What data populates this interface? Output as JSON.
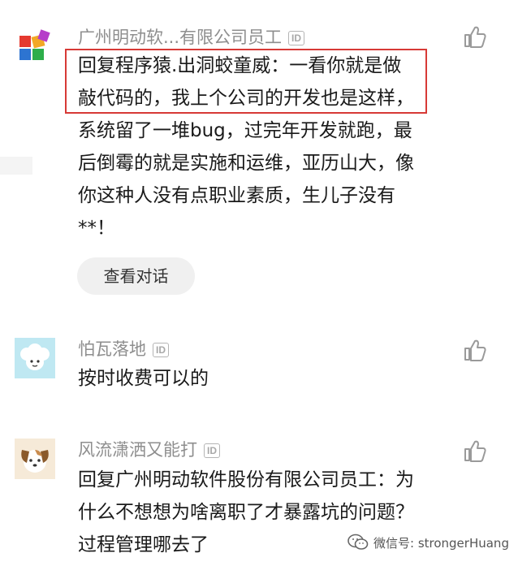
{
  "comments": [
    {
      "author": "广州明动软...有限公司员工",
      "id_badge": "ID",
      "text_highlighted": "回复程序猿.出洞蛟童威：一看你就是做敲代码的，我上个公司的开发也是这",
      "text_rest": "样，系统留了一堆bug，过完年开发就跑，最后倒霉的就是实施和运维，亚历山大，像你这种人没有点职业素质，生儿子没有**！",
      "view_button": "查看对话"
    },
    {
      "author": "怕瓦落地",
      "id_badge": "ID",
      "text": "按时收费可以的"
    },
    {
      "author": "风流潇洒又能打",
      "id_badge": "ID",
      "text": "回复广州明动软件股份有限公司员工：为什么不想想为啥离职了才暴露坑的问题？过程管理哪去了"
    }
  ],
  "watermark": {
    "text": "微信号: strongerHuang"
  },
  "colors": {
    "highlight_border": "#d73a36",
    "name_gray": "#8e8e8e",
    "button_bg": "#f0f0f0"
  },
  "icons": {
    "like": "thumbs-up-icon",
    "wechat": "wechat-icon"
  }
}
